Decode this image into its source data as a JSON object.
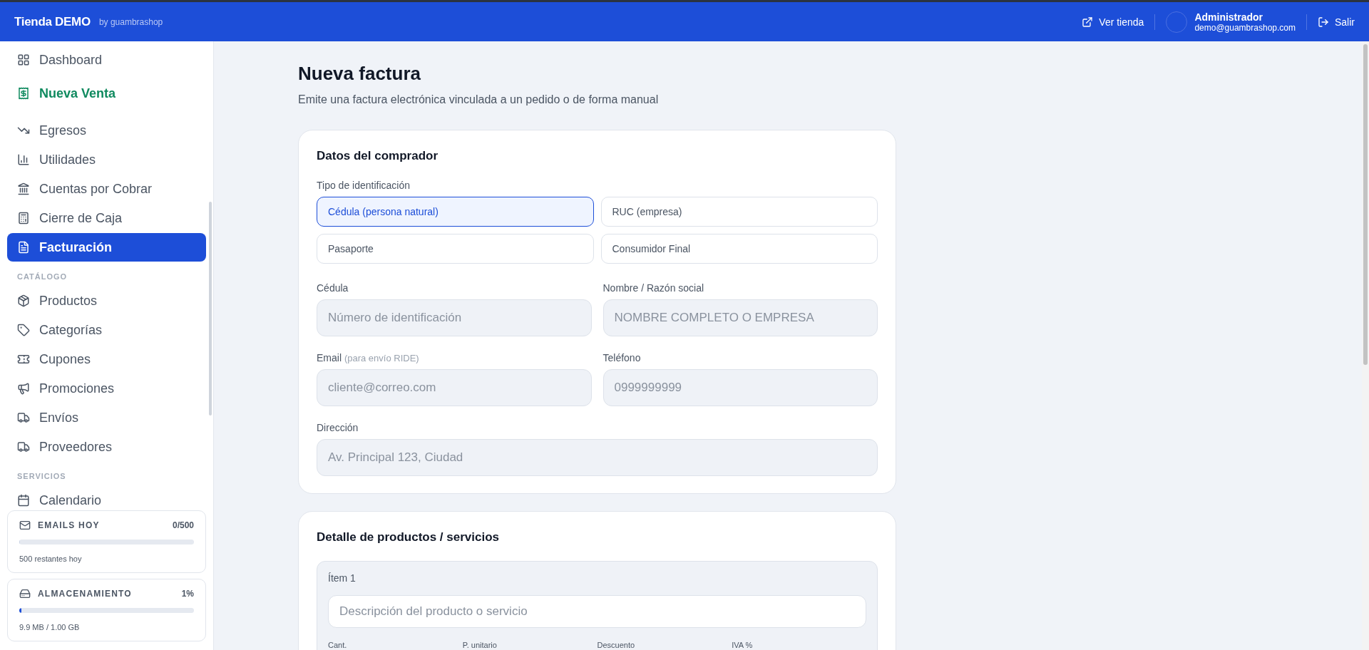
{
  "header": {
    "brand": "Tienda DEMO",
    "brand_sub": "by guambrashop",
    "store_link": "Ver tienda",
    "user_name": "Administrador",
    "user_email": "demo@guambrashop.com",
    "logout": "Salir"
  },
  "sidebar": {
    "items": [
      {
        "kind": "link",
        "label": "Dashboard",
        "selected": false
      },
      {
        "kind": "featured",
        "label": "Nueva Venta",
        "selected": false
      },
      {
        "kind": "link",
        "label": "Egresos",
        "selected": false
      },
      {
        "kind": "link",
        "label": "Utilidades",
        "selected": false
      },
      {
        "kind": "link",
        "label": "Cuentas por Cobrar",
        "selected": false
      },
      {
        "kind": "link",
        "label": "Cierre de Caja",
        "selected": false
      },
      {
        "kind": "link",
        "label": "Facturación",
        "selected": true
      },
      {
        "kind": "section",
        "label": "CATÁLOGO"
      },
      {
        "kind": "link",
        "label": "Productos",
        "selected": false
      },
      {
        "kind": "link",
        "label": "Categorías",
        "selected": false
      },
      {
        "kind": "link",
        "label": "Cupones",
        "selected": false
      },
      {
        "kind": "link",
        "label": "Promociones",
        "selected": false
      },
      {
        "kind": "link",
        "label": "Envíos",
        "selected": false
      },
      {
        "kind": "link",
        "label": "Proveedores",
        "selected": false
      },
      {
        "kind": "section",
        "label": "SERVICIOS"
      },
      {
        "kind": "link",
        "label": "Calendario",
        "selected": false
      }
    ],
    "usage": [
      {
        "title": "EMAILS HOY",
        "value": "0/500",
        "level": 0,
        "note": "500 restantes hoy"
      },
      {
        "title": "ALMACENAMIENTO",
        "value": "1%",
        "level": 0.01,
        "note": "9.9 MB / 1.00 GB"
      }
    ]
  },
  "page": {
    "title": "Nueva factura",
    "subtitle": "Emite una factura electrónica vinculada a un pedido o de forma manual"
  },
  "buyer": {
    "title": "Datos del comprador",
    "id_type_label": "Tipo de identificación",
    "id_types": [
      {
        "label": "Cédula (persona natural)",
        "selected": true
      },
      {
        "label": "RUC (empresa)",
        "selected": false
      },
      {
        "label": "Pasaporte",
        "selected": false
      },
      {
        "label": "Consumidor Final",
        "selected": false
      }
    ],
    "fields": [
      {
        "label": "Cédula",
        "placeholder": "Número de identificación"
      },
      {
        "label": "Nombre / Razón social",
        "placeholder": "NOMBRE COMPLETO O EMPRESA"
      },
      {
        "label": "Email",
        "hint": "(para envío RIDE)",
        "placeholder": "cliente@correo.com"
      },
      {
        "label": "Teléfono",
        "placeholder": "0999999999"
      },
      {
        "label": "Dirección",
        "placeholder": "Av. Principal 123, Ciudad",
        "wide": true
      }
    ]
  },
  "details": {
    "title": "Detalle de productos / servicios",
    "items": [
      {
        "title": "Ítem 1",
        "placeholder": "Descripción del producto o servicio",
        "columns": [
          "Cant.",
          "P. unitario",
          "Descuento",
          "IVA %"
        ]
      }
    ]
  }
}
